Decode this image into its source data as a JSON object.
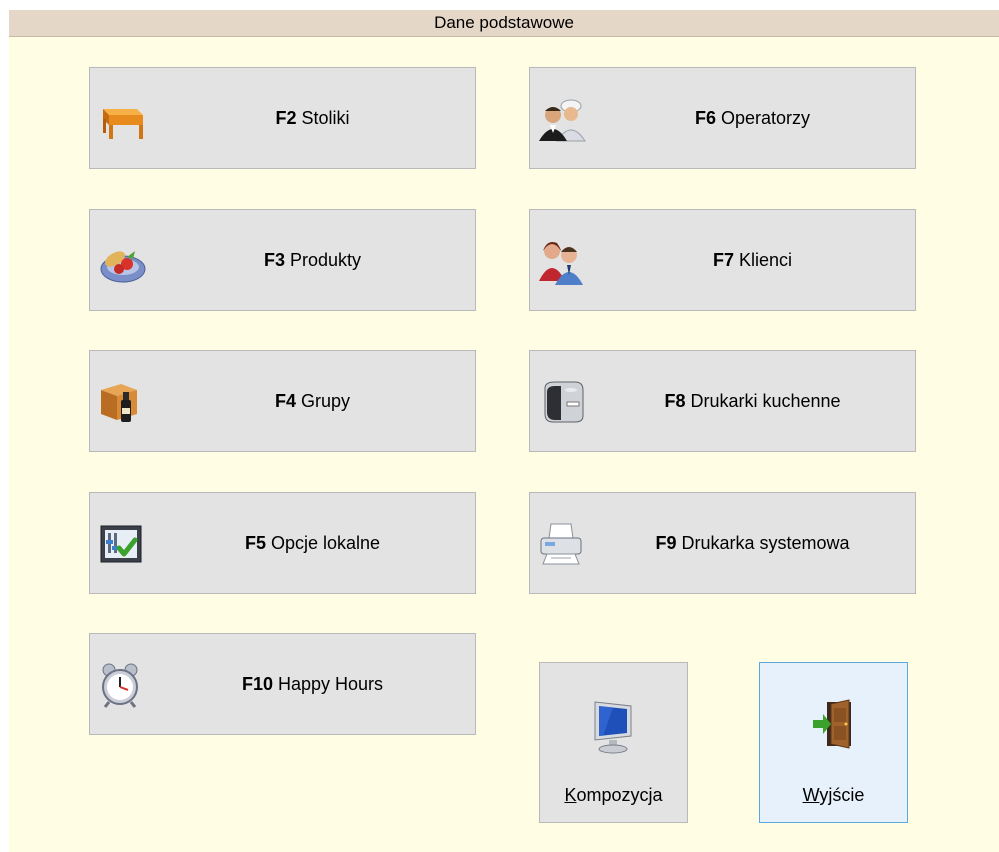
{
  "window": {
    "title": "Dane podstawowe"
  },
  "buttons": [
    {
      "key": "F2",
      "label": "Stoliki",
      "icon": "table-icon"
    },
    {
      "key": "F3",
      "label": "Produkty",
      "icon": "food-plate-icon"
    },
    {
      "key": "F4",
      "label": "Grupy",
      "icon": "box-bottle-icon"
    },
    {
      "key": "F5",
      "label": "Opcje lokalne",
      "icon": "settings-check-icon"
    },
    {
      "key": "F10",
      "label": "Happy Hours",
      "icon": "alarm-clock-icon"
    },
    {
      "key": "F6",
      "label": "Operatorzy",
      "icon": "staff-icon"
    },
    {
      "key": "F7",
      "label": "Klienci",
      "icon": "customers-icon"
    },
    {
      "key": "F8",
      "label": "Drukarki kuchenne",
      "icon": "receipt-printer-icon"
    },
    {
      "key": "F9",
      "label": "Drukarka systemowa",
      "icon": "system-printer-icon"
    }
  ],
  "kompozycja": {
    "accel": "K",
    "rest": "ompozycja",
    "icon": "monitor-icon"
  },
  "wyjscie": {
    "accel": "W",
    "rest": "yjście",
    "icon": "exit-door-icon"
  },
  "colors": {
    "panel_bg": "#fffde4",
    "title_bg": "#e5d7c8",
    "button_bg": "#e3e3e3",
    "active_button_bg": "#e6f1fb",
    "active_button_border": "#5aa8dc"
  }
}
